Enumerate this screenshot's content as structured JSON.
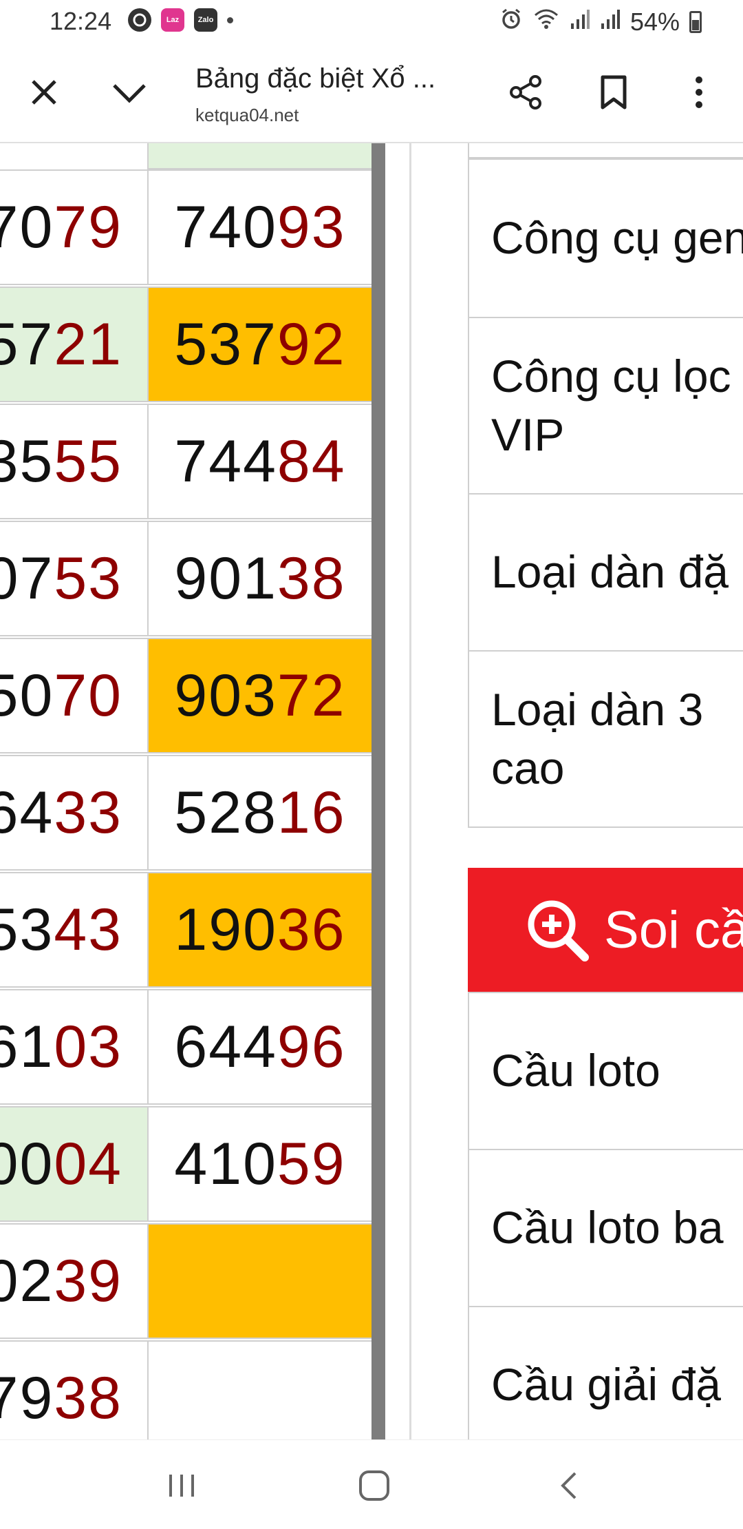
{
  "status_bar": {
    "time": "12:24",
    "battery": "54%",
    "icons": [
      "whatsapp-icon",
      "lazada-icon",
      "zalo-icon",
      "notification-dot-icon",
      "alarm-icon",
      "wifi-icon",
      "signal-icon",
      "signal-icon-2",
      "battery-icon"
    ],
    "laz_label": "Laz",
    "zalo_label": "Zalo"
  },
  "toolbar": {
    "title": "Bảng đặc biệt Xổ ...",
    "url": "ketqua04.net",
    "icons": [
      "close-icon",
      "chevron-down-icon",
      "share-icon",
      "bookmark-icon",
      "more-vert-icon"
    ]
  },
  "table": {
    "rows": [
      {
        "c1_black": "70",
        "c1_red": "79",
        "c1_bg": "white",
        "c2_black": "740",
        "c2_red": "93",
        "c2_bg": "white"
      },
      {
        "c1_black": "57",
        "c1_red": "21",
        "c1_bg": "green",
        "c2_black": "537",
        "c2_red": "92",
        "c2_bg": "yellow"
      },
      {
        "c1_black": "35",
        "c1_red": "55",
        "c1_bg": "white",
        "c2_black": "744",
        "c2_red": "84",
        "c2_bg": "white"
      },
      {
        "c1_black": "07",
        "c1_red": "53",
        "c1_bg": "white",
        "c2_black": "901",
        "c2_red": "38",
        "c2_bg": "white"
      },
      {
        "c1_black": "50",
        "c1_red": "70",
        "c1_bg": "white",
        "c2_black": "903",
        "c2_red": "72",
        "c2_bg": "yellow"
      },
      {
        "c1_black": "64",
        "c1_red": "33",
        "c1_bg": "white",
        "c2_black": "528",
        "c2_red": "16",
        "c2_bg": "white"
      },
      {
        "c1_black": "53",
        "c1_red": "43",
        "c1_bg": "white",
        "c2_black": "190",
        "c2_red": "36",
        "c2_bg": "yellow"
      },
      {
        "c1_black": "61",
        "c1_red": "03",
        "c1_bg": "white",
        "c2_black": "644",
        "c2_red": "96",
        "c2_bg": "white"
      },
      {
        "c1_black": "00",
        "c1_red": "04",
        "c1_bg": "green",
        "c2_black": "410",
        "c2_red": "59",
        "c2_bg": "white"
      },
      {
        "c1_black": "02",
        "c1_red": "39",
        "c1_bg": "white",
        "c2_black": "",
        "c2_red": "",
        "c2_bg": "yellow"
      },
      {
        "c1_black": "79",
        "c1_red": "38",
        "c1_bg": "white",
        "c2_black": "",
        "c2_red": "",
        "c2_bg": "white"
      }
    ]
  },
  "side_menu": {
    "items": [
      {
        "label": "Công cụ gen"
      },
      {
        "label": "Công cụ lọc",
        "label2": "VIP"
      },
      {
        "label": "Loại dàn đặ"
      },
      {
        "label": "Loại dàn 3",
        "label2": "cao"
      }
    ],
    "button": {
      "label": "Soi cầ",
      "icon": "search-plus-icon"
    },
    "items2": [
      {
        "label": "Cầu loto"
      },
      {
        "label": "Cầu loto ba"
      },
      {
        "label": "Cầu giải đặ"
      }
    ]
  },
  "nav_bar": {
    "icons": [
      "recent-apps-icon",
      "home-icon",
      "back-icon"
    ]
  }
}
